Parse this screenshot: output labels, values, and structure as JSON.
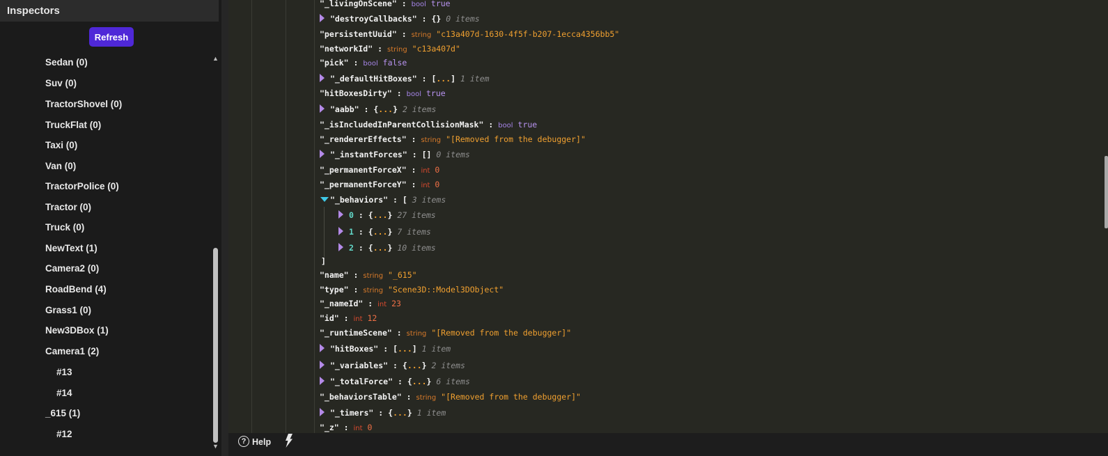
{
  "panel": {
    "title": "Inspectors",
    "refresh_label": "Refresh"
  },
  "tree": [
    {
      "label": "Sedan (0)"
    },
    {
      "label": "Suv (0)"
    },
    {
      "label": "TractorShovel (0)"
    },
    {
      "label": "TruckFlat (0)"
    },
    {
      "label": "Taxi (0)"
    },
    {
      "label": "Van (0)"
    },
    {
      "label": "TractorPolice (0)"
    },
    {
      "label": "Tractor (0)"
    },
    {
      "label": "Truck (0)"
    },
    {
      "label": "NewText (1)"
    },
    {
      "label": "Camera2 (0)"
    },
    {
      "label": "RoadBend (4)"
    },
    {
      "label": "Grass1 (0)"
    },
    {
      "label": "New3DBox (1)"
    },
    {
      "label": "Camera1 (2)"
    },
    {
      "label": "#13"
    },
    {
      "label": "#14"
    },
    {
      "label": "_615 (1)"
    },
    {
      "label": "#12"
    }
  ],
  "inspector": {
    "rows": [
      {
        "key": "\"_livingOnScene\"",
        "sep": ":",
        "type": "bool",
        "value": "true"
      },
      {
        "key": "\"destroyCallbacks\"",
        "sep": ":",
        "bracket": "{}",
        "count": "0 items"
      },
      {
        "key": "\"persistentUuid\"",
        "sep": ":",
        "type": "string",
        "value": "\"c13a407d-1630-4f5f-b207-1ecca4356bb5\""
      },
      {
        "key": "\"networkId\"",
        "sep": ":",
        "type": "string",
        "value": "\"c13a407d\""
      },
      {
        "key": "\"pick\"",
        "sep": ":",
        "type": "bool",
        "value": "false"
      },
      {
        "key": "\"_defaultHitBoxes\"",
        "sep": ":",
        "bracket_open": "[",
        "dots": "...",
        "bracket_close": "]",
        "count": "1 item"
      },
      {
        "key": "\"hitBoxesDirty\"",
        "sep": ":",
        "type": "bool",
        "value": "true"
      },
      {
        "key": "\"aabb\"",
        "sep": ":",
        "bracket_open": "{",
        "dots": "...",
        "bracket_close": "}",
        "count": "2 items"
      },
      {
        "key": "\"_isIncludedInParentCollisionMask\"",
        "sep": ":",
        "type": "bool",
        "value": "true"
      },
      {
        "key": "\"_rendererEffects\"",
        "sep": ":",
        "type": "string",
        "value": "\"[Removed from the debugger]\""
      },
      {
        "key": "\"_instantForces\"",
        "sep": ":",
        "bracket": "[]",
        "count": "0 items"
      },
      {
        "key": "\"_permanentForceX\"",
        "sep": ":",
        "type": "int",
        "value": "0"
      },
      {
        "key": "\"_permanentForceY\"",
        "sep": ":",
        "type": "int",
        "value": "0"
      },
      {
        "key": "\"_behaviors\"",
        "sep": ":",
        "bracket_open": "[",
        "count": "3 items"
      },
      {
        "key": "0",
        "sep": ":",
        "bracket_open": "{",
        "dots": "...",
        "bracket_close": "}",
        "count": "27 items"
      },
      {
        "key": "1",
        "sep": ":",
        "bracket_open": "{",
        "dots": "...",
        "bracket_close": "}",
        "count": "7 items"
      },
      {
        "key": "2",
        "sep": ":",
        "bracket_open": "{",
        "dots": "...",
        "bracket_close": "}",
        "count": "10 items"
      },
      {
        "bracket_close": "]"
      },
      {
        "key": "\"name\"",
        "sep": ":",
        "type": "string",
        "value": "\"_615\""
      },
      {
        "key": "\"type\"",
        "sep": ":",
        "type": "string",
        "value": "\"Scene3D::Model3DObject\""
      },
      {
        "key": "\"_nameId\"",
        "sep": ":",
        "type": "int",
        "value": "23"
      },
      {
        "key": "\"id\"",
        "sep": ":",
        "type": "int",
        "value": "12"
      },
      {
        "key": "\"_runtimeScene\"",
        "sep": ":",
        "type": "string",
        "value": "\"[Removed from the debugger]\""
      },
      {
        "key": "\"hitBoxes\"",
        "sep": ":",
        "bracket_open": "[",
        "dots": "...",
        "bracket_close": "]",
        "count": "1 item"
      },
      {
        "key": "\"_variables\"",
        "sep": ":",
        "bracket_open": "{",
        "dots": "...",
        "bracket_close": "}",
        "count": "2 items"
      },
      {
        "key": "\"_totalForce\"",
        "sep": ":",
        "bracket_open": "{",
        "dots": "...",
        "bracket_close": "}",
        "count": "6 items"
      },
      {
        "key": "\"_behaviorsTable\"",
        "sep": ":",
        "type": "string",
        "value": "\"[Removed from the debugger]\""
      },
      {
        "key": "\"_timers\"",
        "sep": ":",
        "bracket_open": "{",
        "dots": "...",
        "bracket_close": "}",
        "count": "1 item"
      },
      {
        "key": "\"_z\"",
        "sep": ":",
        "type": "int",
        "value": "0"
      }
    ]
  },
  "footer": {
    "help_icon": "?",
    "help_label": "Help",
    "icons": [
      "help-circle-icon",
      "lightning-icon"
    ]
  },
  "colors": {
    "accent": "#4f28d8",
    "key": "#f2f2f2",
    "string_value": "#f0a030",
    "bool_value": "#b893f0",
    "int_value": "#f07046",
    "expand_arrow": "#b48ae8",
    "expanded_arrow": "#3ec8e6",
    "index_key": "#62d8c8",
    "count": "#8f8f8f"
  }
}
